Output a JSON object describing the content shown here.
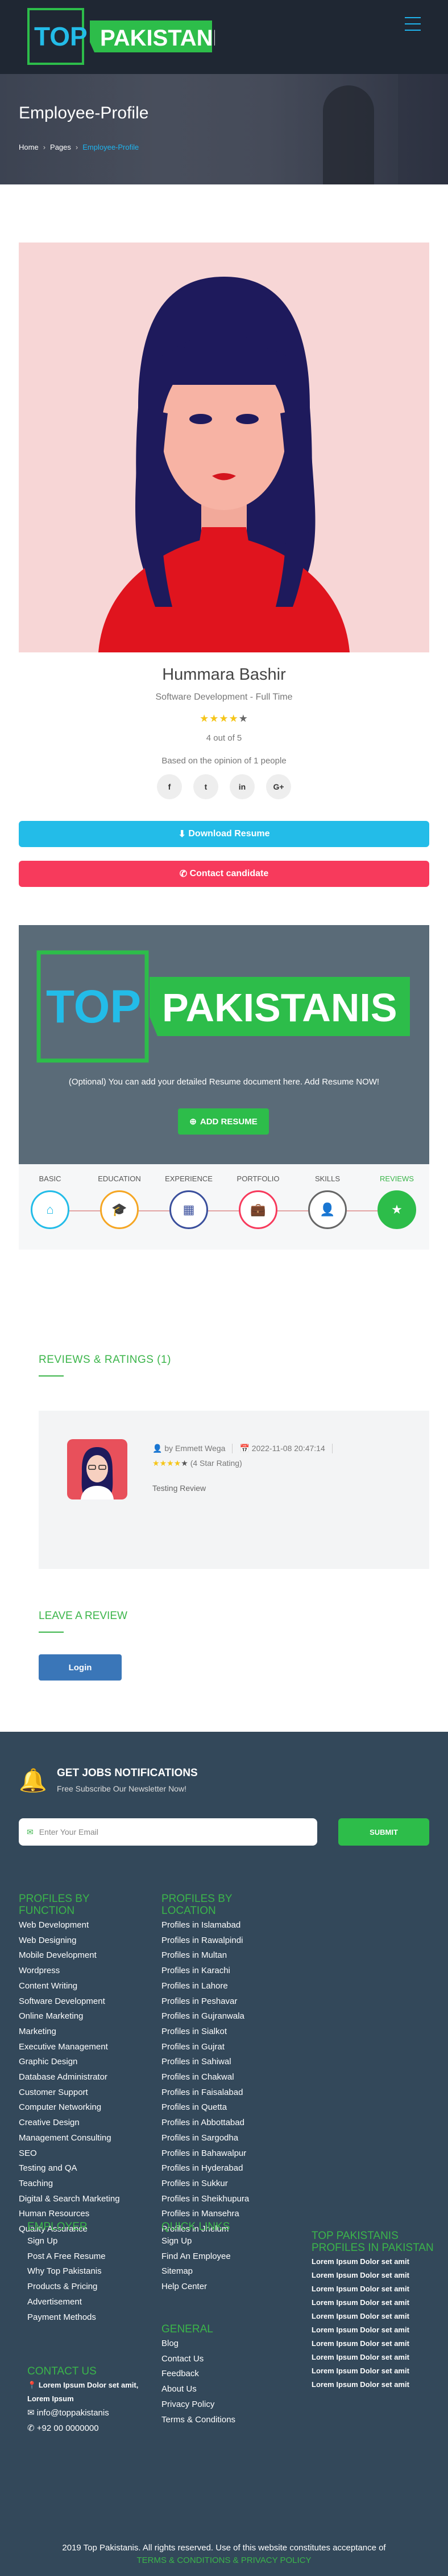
{
  "header": {
    "logo_top": "TOP",
    "logo_main": "PAKISTANIS"
  },
  "hero": {
    "title": "Employee-Profile",
    "crumbs": [
      "Home",
      "Pages",
      "Employee-Profile"
    ]
  },
  "profile": {
    "name": "Hummara Bashir",
    "role": "Software Development - Full Time",
    "stars": {
      "filled": 4,
      "total": 5
    },
    "rating_text": "4 out of 5",
    "opinion": "Based on the opinion of 1 people",
    "socials": [
      "f",
      "t",
      "in",
      "G+"
    ]
  },
  "actions": {
    "download": "Download Resume",
    "contact": "Contact candidate"
  },
  "resume": {
    "logo_top": "TOP",
    "logo_main": "PAKISTANIS",
    "note": "(Optional) You can add your detailed Resume document here. Add Resume NOW!",
    "add": "ADD RESUME"
  },
  "steps": [
    {
      "label": "BASIC",
      "icon": "home-icon",
      "color": "#23bce8"
    },
    {
      "label": "EDUCATION",
      "icon": "graduation-cap-icon",
      "color": "#f5a623"
    },
    {
      "label": "EXPERIENCE",
      "icon": "briefcase-grid-icon",
      "color": "#3a4f9c"
    },
    {
      "label": "PORTFOLIO",
      "icon": "portfolio-icon",
      "color": "#f73a5c"
    },
    {
      "label": "SKILLS",
      "icon": "user-icon",
      "color": "#666666"
    },
    {
      "label": "REVIEWS",
      "icon": "star-icon",
      "color": "#2dbd4a"
    }
  ],
  "reviews": {
    "title": "REVIEWS & RATINGS (1)",
    "by": "by Emmett Wega",
    "date": "2022-11-08 20:47:14",
    "rating": "(4 Star Rating)",
    "stars": 4,
    "text": "Testing Review"
  },
  "leave": {
    "title": "LEAVE A REVIEW",
    "login": "Login"
  },
  "newsletter": {
    "title": "GET JOBS NOTIFICATIONS",
    "sub": "Free Subscribe Our Newsletter Now!",
    "placeholder": "Enter Your Email",
    "submit": "SUBMIT"
  },
  "footer": {
    "by_function": {
      "title": "PROFILES BY FUNCTION",
      "items": [
        "Web Development",
        "Web Designing",
        "Mobile Development",
        "Wordpress",
        "Content Writing",
        "Software Development",
        "Online Marketing",
        "Marketing",
        "Executive Management",
        "Graphic Design",
        "Database Administrator",
        "Customer Support",
        "Computer Networking",
        "Creative Design",
        "Management Consulting",
        "SEO",
        "Testing and QA",
        "Teaching",
        "Digital & Search Marketing",
        "Human Resources",
        "Quality Assurance"
      ]
    },
    "by_location": {
      "title": "PROFILES BY LOCATION",
      "items": [
        "Profiles in Islamabad",
        "Profiles in Rawalpindi",
        "Profiles in Multan",
        "Profiles in Karachi",
        "Profiles in Lahore",
        "Profiles in Peshavar",
        "Profiles in Gujranwala",
        "Profiles in Sialkot",
        "Profiles in Gujrat",
        "Profiles in Sahiwal",
        "Profiles in Chakwal",
        "Profiles in Faisalabad",
        "Profiles in Quetta",
        "Profiles in Abbottabad",
        "Profiles in Sargodha",
        "Profiles in Bahawalpur",
        "Profiles in Hyderabad",
        "Profiles in Sukkur",
        "Profiles in Sheikhupura",
        "Profiles in Mansehra",
        "Profiles in Jhelum"
      ]
    },
    "employer": {
      "title": "EMPLOYER",
      "items": [
        "Sign Up",
        "Post A Free Resume",
        "Why Top Pakistanis",
        "Products & Pricing",
        "Advertisement",
        "Payment Methods"
      ]
    },
    "quick": {
      "title": "QUICK LINKS",
      "items": [
        "Sign Up",
        "Find An Employee",
        "Sitemap",
        "Help Center"
      ]
    },
    "general": {
      "title": "GENERAL",
      "items": [
        "Blog",
        "Contact Us",
        "Feedback",
        "About Us",
        "Privacy Policy",
        "Terms & Conditions"
      ]
    },
    "provinces": {
      "title": "TOP PAKISTANIS PROFILES IN PAKISTAN",
      "items": [
        "Lorem Ipsum Dolor set amit",
        "Lorem Ipsum Dolor set amit",
        "Lorem Ipsum Dolor set amit",
        "Lorem Ipsum Dolor set amit",
        "Lorem Ipsum Dolor set amit",
        "Lorem Ipsum Dolor set amit",
        "Lorem Ipsum Dolor set amit",
        "Lorem Ipsum Dolor set amit",
        "Lorem Ipsum Dolor set amit",
        "Lorem Ipsum Dolor set amit"
      ]
    },
    "contact": {
      "title": "CONTACT US",
      "address": "Lorem Ipsum Dolor set amit, Lorem Ipsum",
      "email": "info@toppakistanis",
      "phone": "+92 00 0000000"
    },
    "copyright": "2019 Top Pakistanis. All rights reserved. Use of this website constitutes acceptance of",
    "terms": "TERMS & CONDITIONS & PRIVACY POLICY"
  },
  "colors": {
    "accent_green": "#3bb54a",
    "accent_blue": "#23bce8",
    "accent_red": "#f73a5c"
  }
}
